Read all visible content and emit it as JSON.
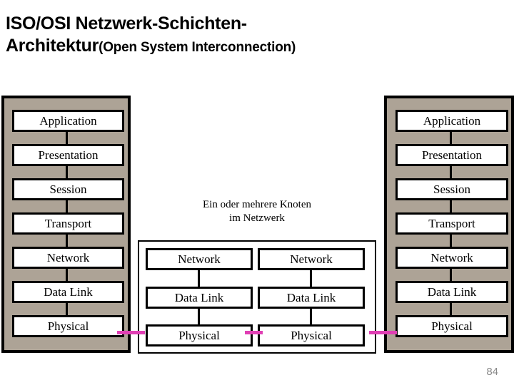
{
  "slide": {
    "title_line1": "ISO/OSI Netzwerk-Schichten-",
    "title_line2_main": "Architektur",
    "title_line2_sub": "(Open System Interconnection)",
    "page_number": "84",
    "colors": {
      "panel_fill": "#ada396",
      "box_fill": "#ffffff",
      "border": "#000000",
      "link": "#e03fb4",
      "page_number": "#8a8a8a",
      "background": "#ffffff"
    }
  },
  "left_stack": {
    "name": "Endsystem links",
    "layers": [
      {
        "label": "Application"
      },
      {
        "label": "Presentation"
      },
      {
        "label": "Session"
      },
      {
        "label": "Transport"
      },
      {
        "label": "Network"
      },
      {
        "label": "Data Link"
      },
      {
        "label": "Physical"
      }
    ]
  },
  "right_stack": {
    "name": "Endsystem rechts",
    "layers": [
      {
        "label": "Application"
      },
      {
        "label": "Presentation"
      },
      {
        "label": "Session"
      },
      {
        "label": "Transport"
      },
      {
        "label": "Network"
      },
      {
        "label": "Data Link"
      },
      {
        "label": "Physical"
      }
    ]
  },
  "network": {
    "caption_line1": "Ein oder mehrere Knoten",
    "caption_line2": "im Netzwerk",
    "nodes": [
      {
        "layers": [
          {
            "label": "Network"
          },
          {
            "label": "Data Link"
          },
          {
            "label": "Physical"
          }
        ]
      },
      {
        "layers": [
          {
            "label": "Network"
          },
          {
            "label": "Data Link"
          },
          {
            "label": "Physical"
          }
        ]
      }
    ]
  }
}
